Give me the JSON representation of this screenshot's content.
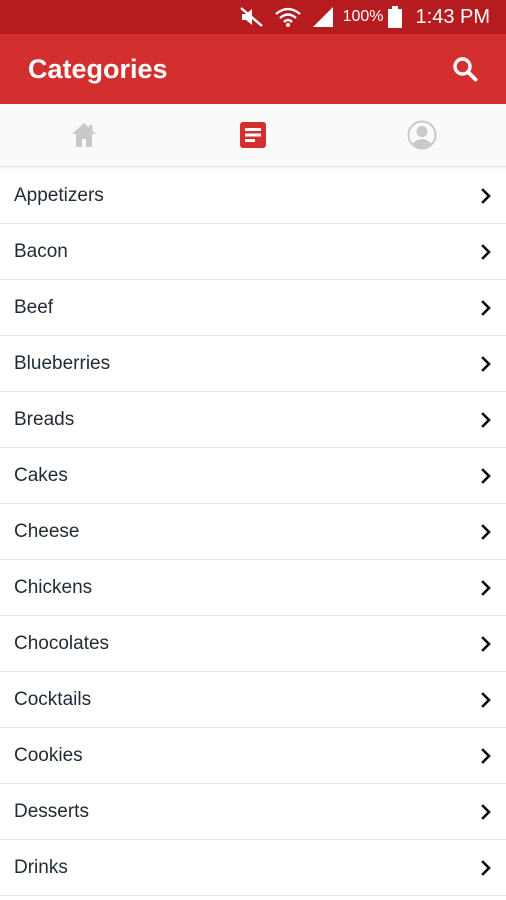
{
  "status_bar": {
    "battery_percent": "100%",
    "time": "1:43 PM",
    "icons": [
      "mute-icon",
      "wifi-icon",
      "signal-icon",
      "battery-icon"
    ]
  },
  "app_bar": {
    "title": "Categories",
    "search_icon": "search-icon"
  },
  "tabs": [
    {
      "icon": "home-icon",
      "active": false
    },
    {
      "icon": "list-icon",
      "active": true
    },
    {
      "icon": "profile-icon",
      "active": false
    }
  ],
  "categories": [
    "Appetizers",
    "Bacon",
    "Beef",
    "Blueberries",
    "Breads",
    "Cakes",
    "Cheese",
    "Chickens",
    "Chocolates",
    "Cocktails",
    "Cookies",
    "Desserts",
    "Drinks"
  ],
  "colors": {
    "status_bar": "#b61b1f",
    "app_bar": "#d32f2f",
    "active_tab": "#d32f2f",
    "inactive_tab": "#c9c9c9"
  }
}
